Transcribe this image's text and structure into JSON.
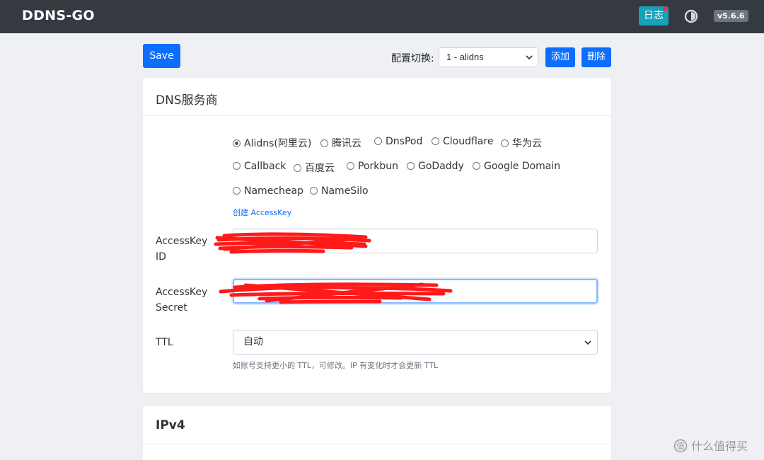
{
  "navbar": {
    "brand": "DDNS-GO",
    "log_button": "日志",
    "theme_toggle_icon": "half-circle-icon",
    "version": "v5.6.6"
  },
  "toolbar": {
    "save_label": "Save",
    "profile_switch_label": "配置切换:",
    "profile_selected": "1 - alidns",
    "add_label": "添加",
    "delete_label": "删除"
  },
  "dns_card": {
    "title": "DNS服务商",
    "providers": [
      {
        "label": "Alidns(阿里云)",
        "checked": true
      },
      {
        "label": "腾讯云",
        "checked": false
      },
      {
        "label": "DnsPod",
        "checked": false
      },
      {
        "label": "Cloudflare",
        "checked": false
      },
      {
        "label": "华为云",
        "checked": false
      },
      {
        "label": "Callback",
        "checked": false
      },
      {
        "label": "百度云",
        "checked": false
      },
      {
        "label": "Porkbun",
        "checked": false
      },
      {
        "label": "GoDaddy",
        "checked": false
      },
      {
        "label": "Google Domain",
        "checked": false
      },
      {
        "label": "Namecheap",
        "checked": false
      },
      {
        "label": "NameSilo",
        "checked": false
      }
    ],
    "create_link": "创建 AccessKey",
    "access_key_id_label": [
      "AccessKey",
      "ID"
    ],
    "access_key_secret_label": [
      "AccessKey",
      "Secret"
    ],
    "ttl_label": "TTL",
    "ttl_value": "自动",
    "ttl_help": "如账号支持更小的 TTL，可修改。IP 有变化时才会更新 TTL"
  },
  "ipv4_card": {
    "title": "IPv4"
  },
  "watermark": {
    "text": "什么值得买",
    "icon": "smzdm-logo-icon"
  },
  "colors": {
    "navbar_bg": "#343a40",
    "primary": "#0d6efd",
    "log_button": "#17a2b8",
    "redaction": "#ff1a1a"
  }
}
